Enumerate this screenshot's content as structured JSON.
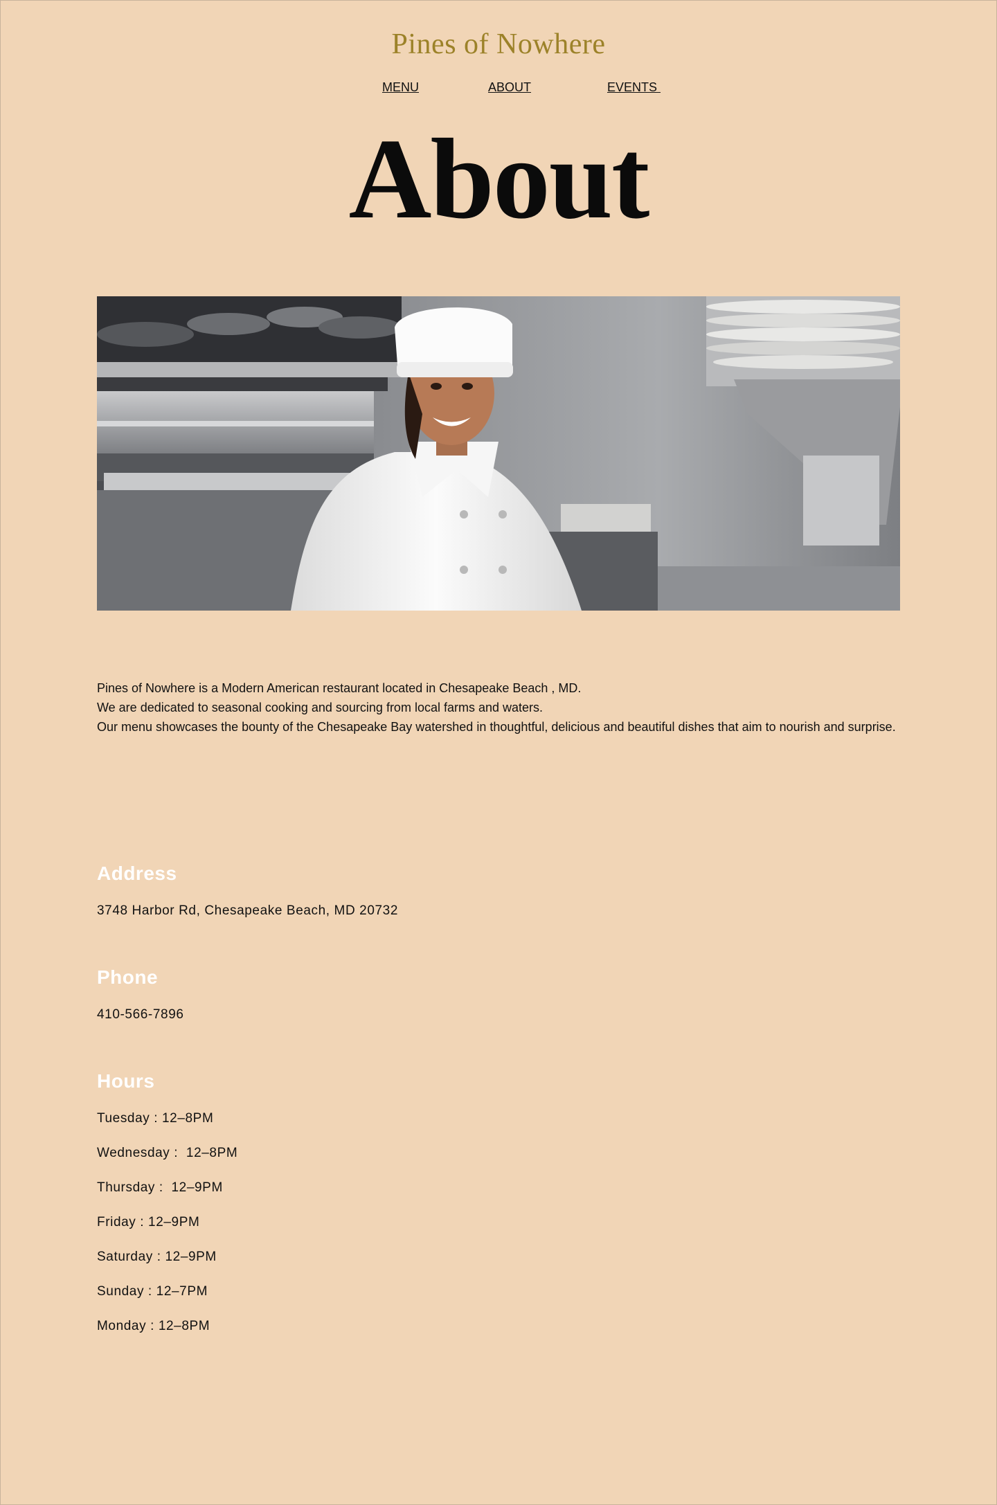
{
  "site": {
    "title": "Pines of Nowhere"
  },
  "nav": {
    "items": [
      {
        "label": "MENU"
      },
      {
        "label": "ABOUT"
      },
      {
        "label": "EVENTS "
      }
    ]
  },
  "page": {
    "heading": "About"
  },
  "hero": {
    "alt": "Smiling chef in white uniform and hat standing in a restaurant kitchen"
  },
  "intro": {
    "lines": [
      "Pines of Nowhere is a Modern American restaurant located in Chesapeake Beach , MD.",
      "We are dedicated to seasonal cooking and sourcing from local farms and waters.",
      "Our menu showcases the bounty of the Chesapeake Bay watershed in thoughtful, delicious and beautiful dishes that aim to nourish and surprise."
    ]
  },
  "address": {
    "heading": "Address",
    "value": "3748 Harbor Rd, Chesapeake Beach, MD 20732"
  },
  "phone": {
    "heading": "Phone",
    "value": "410-566-7896"
  },
  "hours": {
    "heading": "Hours",
    "items": [
      "Tuesday : 12–8PM",
      "Wednesday :  12–8PM",
      "Thursday :  12–9PM",
      "Friday : 12–9PM",
      "Saturday : 12–9PM",
      "Sunday : 12–7PM",
      "Monday : 12–8PM"
    ]
  },
  "colors": {
    "background": "#f1d5b6",
    "site_title": "#9c8229",
    "section_heading": "#ffffff"
  }
}
